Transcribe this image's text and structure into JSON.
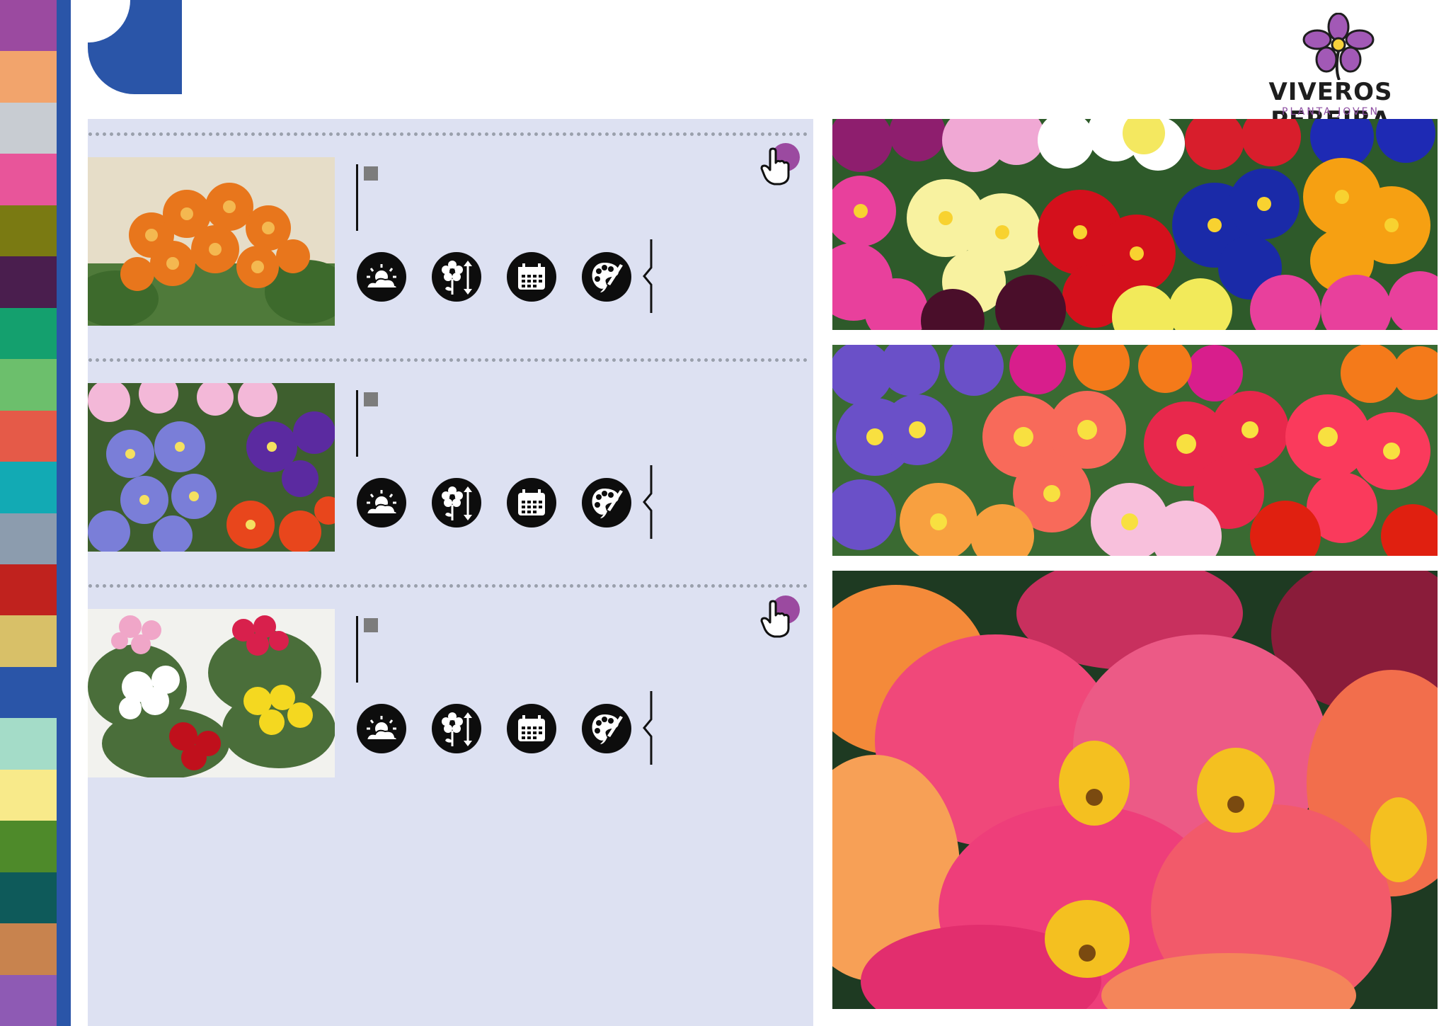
{
  "palette": [
    "#9b4aa0",
    "#f2a46c",
    "#c8ccd2",
    "#e8559a",
    "#7a7a12",
    "#4a1e4e",
    "#14a06e",
    "#6cbf6c",
    "#e55a48",
    "#12aab4",
    "#8c9cae",
    "#c0221e",
    "#d8c068",
    "#2a55a8",
    "#a4dcc8",
    "#f8ea8a",
    "#4e8a2a",
    "#0e5a5a",
    "#c8834e",
    "#8e5ab4"
  ],
  "brand": {
    "name": "VIVEROS PEREIRA",
    "tagline": "PLANTA JOVEN",
    "accent": "#2a55a8",
    "logo_purple": "#8e4fa3"
  },
  "products": [
    {
      "icons": [
        "sun-cloud-icon",
        "flower-height-icon",
        "calendar-icon",
        "palette-icon"
      ],
      "has_link": true
    },
    {
      "icons": [
        "sun-cloud-icon",
        "flower-height-icon",
        "calendar-icon",
        "palette-icon"
      ],
      "has_link": false
    },
    {
      "icons": [
        "sun-cloud-icon",
        "flower-height-icon",
        "calendar-icon",
        "palette-icon"
      ],
      "has_link": true
    }
  ]
}
